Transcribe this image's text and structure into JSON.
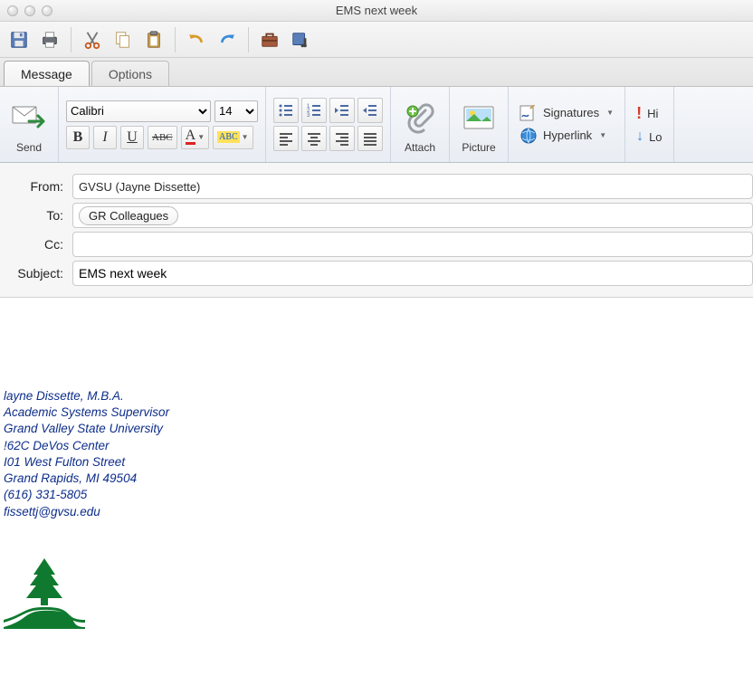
{
  "window": {
    "title": "EMS next week"
  },
  "tabs": {
    "message": "Message",
    "options": "Options"
  },
  "ribbon": {
    "send_label": "Send",
    "font_name": "Calibri",
    "font_size": "14",
    "attach_label": "Attach",
    "picture_label": "Picture",
    "signatures_label": "Signatures",
    "hyperlink_label": "Hyperlink",
    "hi_label": "Hi",
    "lo_label": "Lo"
  },
  "format_buttons": {
    "bold": "B",
    "italic": "I",
    "underline": "U",
    "strike": "ABC",
    "fontcolor": "A",
    "highlight": "ABC"
  },
  "fields": {
    "from_label": "From:",
    "from_value": "GVSU (Jayne Dissette)",
    "to_label": "To:",
    "to_value": "GR Colleagues",
    "cc_label": "Cc:",
    "cc_value": "",
    "subject_label": "Subject:",
    "subject_value": "EMS next week"
  },
  "signature": {
    "line1": "layne Dissette, M.B.A.",
    "line2": "Academic Systems Supervisor",
    "line3": "Grand Valley State University",
    "line4": "!62C DeVos Center",
    "line5": "I01 West Fulton Street",
    "line6": "Grand Rapids, MI  49504",
    "line7": "(616) 331-5805",
    "line8": "fissettj@gvsu.edu"
  },
  "icons": {
    "save": "save-icon",
    "print": "print-icon",
    "cut": "cut-icon",
    "copy": "copy-icon",
    "paste": "paste-icon",
    "undo": "undo-icon",
    "redo": "redo-icon",
    "toolbox": "toolbox-icon",
    "media": "media-icon"
  }
}
